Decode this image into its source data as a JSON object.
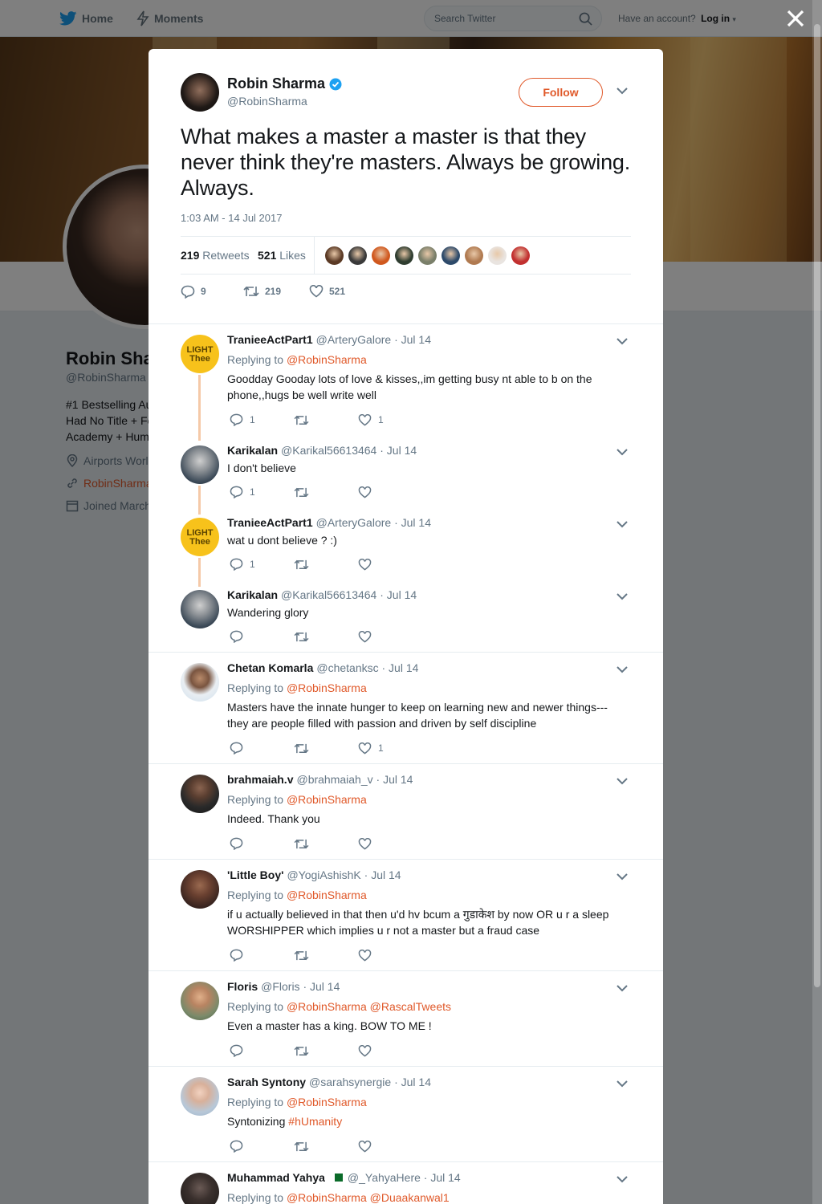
{
  "nav": {
    "home_label": "Home",
    "moments_label": "Moments",
    "search_placeholder": "Search Twitter",
    "have_account_text": "Have an account?",
    "login_label": "Log in"
  },
  "profile": {
    "name_partial": "Robin Sha",
    "handle": "@RobinSharma",
    "bio_lines": [
      "#1 Bestselling Au",
      "Had No Title + Fe",
      "Academy + Hum"
    ],
    "location_partial": "Airports Worl",
    "link_partial": "RobinSharma",
    "joined_partial": "Joined March"
  },
  "main_tweet": {
    "name": "Robin Sharma",
    "handle": "@RobinSharma",
    "follow_label": "Follow",
    "text": "What makes a master a master is that they never think they're masters. Always be growing. Always.",
    "timestamp": "1:03 AM - 14 Jul 2017",
    "retweets_count": "219",
    "retweets_label": "Retweets",
    "likes_count": "521",
    "likes_label": "Likes",
    "reply_count": "9",
    "retweet_action_count": "219",
    "like_action_count": "521",
    "liker_colors": [
      "#5b3a25",
      "#3a3a3a",
      "#d0581e",
      "#2f3d30",
      "#7a7f6a",
      "#2d4a6a",
      "#b07a50",
      "#e9e4e0",
      "#c23030"
    ]
  },
  "replies": [
    {
      "name": "TranieeActPart1",
      "handle": "@ArteryGalore",
      "date": "· Jul 14",
      "replying_prefix": "Replying to",
      "mention": "@RobinSharma",
      "text": "Goodday Gooday lots of love & kisses,,im getting busy nt able to b on the phone,,hugs be well write well",
      "reply_count": "1",
      "like_count": "1",
      "avatar_text": "LIGHT\nThee"
    },
    {
      "name": "Karikalan",
      "handle": "@Karikal56613464",
      "date": "· Jul 14",
      "text": "I don't believe",
      "reply_count": "1",
      "like_count": ""
    },
    {
      "name": "TranieeActPart1",
      "handle": "@ArteryGalore",
      "date": "· Jul 14",
      "text": "wat u dont believe ? :)",
      "reply_count": "1",
      "like_count": "",
      "avatar_text": "LIGHT\nThee"
    },
    {
      "name": "Karikalan",
      "handle": "@Karikal56613464",
      "date": "· Jul 14",
      "text": "Wandering glory",
      "reply_count": "",
      "like_count": ""
    },
    {
      "name": "Chetan Komarla",
      "handle": "@chetanksc",
      "date": "· Jul 14",
      "replying_prefix": "Replying to",
      "mention": "@RobinSharma",
      "text": "Masters have the innate hunger to keep on learning new and newer things---they are people filled with passion and driven by self discipline",
      "reply_count": "",
      "like_count": "1"
    },
    {
      "name": "brahmaiah.v",
      "handle": "@brahmaiah_v",
      "date": "· Jul 14",
      "replying_prefix": "Replying to",
      "mention": "@RobinSharma",
      "text": "Indeed. Thank you",
      "reply_count": "",
      "like_count": ""
    },
    {
      "name": "'Little Boy'",
      "handle": "@YogiAshishK",
      "date": "· Jul 14",
      "replying_prefix": "Replying to",
      "mention": "@RobinSharma",
      "text": "if u actually believed in that then u'd hv bcum a गुडाकेश  by now OR u r a sleep WORSHIPPER which implies u r not a master but a fraud case",
      "reply_count": "",
      "like_count": ""
    },
    {
      "name": "Floris",
      "handle": "@Floris",
      "date": "· Jul 14",
      "replying_prefix": "Replying to",
      "mention": "@RobinSharma @RascalTweets",
      "text": "Even a master has a king. BOW TO ME !",
      "reply_count": "",
      "like_count": ""
    },
    {
      "name": "Sarah Syntony",
      "handle": "@sarahsynergie",
      "date": "· Jul 14",
      "replying_prefix": "Replying to",
      "mention": "@RobinSharma",
      "text_prefix": "Syntonizing",
      "hashtag": "#hUmanity",
      "reply_count": "",
      "like_count": ""
    },
    {
      "name": "Muhammad Yahya",
      "handle": "@_YahyaHere",
      "date": "· Jul 14",
      "replying_prefix": "Replying to",
      "mention": "@RobinSharma @Duaakanwal1"
    }
  ],
  "colors": {
    "accent": "#e0592a",
    "link_blue": "#1da1f2",
    "thread_line": "#f5c9a8"
  }
}
